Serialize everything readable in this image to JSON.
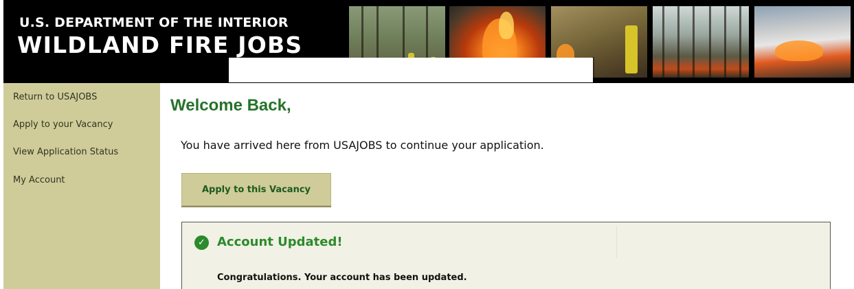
{
  "header": {
    "line1": "U.S. DEPARTMENT OF THE INTERIOR",
    "line2": "WILDLAND FIRE JOBS",
    "photos": [
      "forest-crew-photo",
      "flames-photo",
      "firefighter-photo",
      "forest-fire-photo",
      "smoke-plume-photo"
    ]
  },
  "sidebar": {
    "items": [
      {
        "label": "Return to USAJOBS"
      },
      {
        "label": "Apply to your Vacancy"
      },
      {
        "label": "View Application Status"
      },
      {
        "label": "My Account"
      }
    ]
  },
  "main": {
    "heading": "Welcome Back,",
    "intro": "You have arrived here from USAJOBS to continue your application.",
    "apply_button": "Apply to this Vacancy"
  },
  "notice": {
    "icon": "check-circle-icon",
    "title": "Account Updated!",
    "body": "Congratulations. Your account has been updated."
  },
  "colors": {
    "sidebar_bg": "#cfcc99",
    "heading_green": "#267229",
    "success_green": "#2b8a2b",
    "notice_bg": "#f1f1e5"
  }
}
